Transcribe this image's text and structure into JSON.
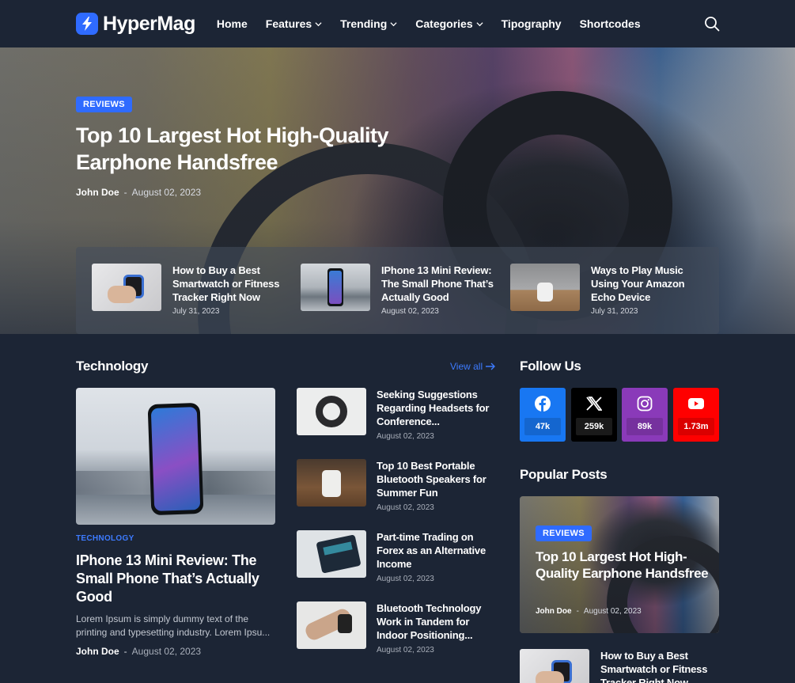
{
  "header": {
    "logo_text": "HyperMag",
    "nav": [
      {
        "label": "Home",
        "dropdown": false
      },
      {
        "label": "Features",
        "dropdown": true
      },
      {
        "label": "Trending",
        "dropdown": true
      },
      {
        "label": "Categories",
        "dropdown": true
      },
      {
        "label": "Tipography",
        "dropdown": false
      },
      {
        "label": "Shortcodes",
        "dropdown": false
      }
    ],
    "search_icon": "search-icon"
  },
  "hero": {
    "category": "REVIEWS",
    "title": "Top 10 Largest Hot High-Quality Earphone Handsfree",
    "author": "John Doe",
    "separator": "-",
    "date": "August 02, 2023",
    "strip": [
      {
        "title": "How to Buy a Best Smartwatch or Fitness Tracker Right Now",
        "date": "July 31, 2023"
      },
      {
        "title": "IPhone 13 Mini Review: The Small Phone That’s Actually Good",
        "date": "August 02, 2023"
      },
      {
        "title": "Ways to Play Music Using Your Amazon Echo Device",
        "date": "July 31, 2023"
      }
    ]
  },
  "technology": {
    "title": "Technology",
    "view_all": "View all",
    "main": {
      "category": "TECHNOLOGY",
      "title": "IPhone 13 Mini Review: The Small Phone That’s Actually Good",
      "excerpt": "Lorem Ipsum is simply dummy text of the printing and typesetting industry. Lorem Ipsu...",
      "author": "John Doe",
      "separator": "-",
      "date": "August 02, 2023"
    },
    "list": [
      {
        "title": "Seeking Suggestions Regarding Headsets for Conference...",
        "date": "August 02, 2023"
      },
      {
        "title": "Top 10 Best Portable Bluetooth Speakers for Summer Fun",
        "date": "August 02, 2023"
      },
      {
        "title": "Part-time Trading on Forex as an Alternative Income",
        "date": "August 02, 2023"
      },
      {
        "title": "Bluetooth Technology Work in Tandem for Indoor Positioning...",
        "date": "August 02, 2023"
      }
    ]
  },
  "follow": {
    "title": "Follow Us",
    "networks": [
      {
        "name": "facebook-icon",
        "count": "47k",
        "color": "#1877f2"
      },
      {
        "name": "x-icon",
        "count": "259k",
        "color": "#000000"
      },
      {
        "name": "instagram-icon",
        "count": "89k",
        "color": "#8a3ab9"
      },
      {
        "name": "youtube-icon",
        "count": "1.73m",
        "color": "#ff0000"
      }
    ]
  },
  "popular": {
    "title": "Popular Posts",
    "featured": {
      "category": "REVIEWS",
      "title": "Top 10 Largest Hot High-Quality Earphone Handsfree",
      "author": "John Doe",
      "separator": "-",
      "date": "August 02, 2023"
    },
    "next": {
      "title": "How to Buy a Best Smartwatch or Fitness Tracker Right Now"
    }
  },
  "colors": {
    "background": "#1c2535",
    "accent": "#2f6bff",
    "link": "#3d7bff"
  }
}
